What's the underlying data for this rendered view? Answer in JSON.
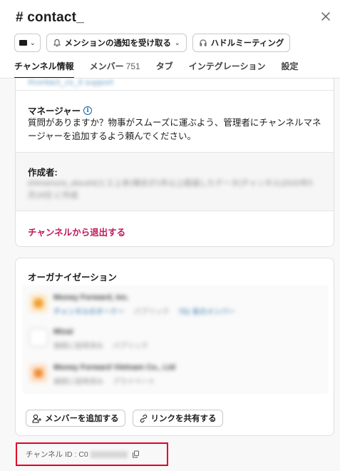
{
  "header": {
    "title": "# contact_",
    "toolbar": {
      "chip_caret": "⌄",
      "notify_label": "メンションの通知を受け取る",
      "notify_caret": "⌄",
      "huddle_label": "ハドルミーティング"
    },
    "tabs": [
      {
        "label": "チャンネル情報",
        "active": true
      },
      {
        "label": "メンバー",
        "count": "751"
      },
      {
        "label": "タブ"
      },
      {
        "label": "インテグレーション"
      },
      {
        "label": "設定"
      }
    ]
  },
  "about": {
    "cut_link": "#contact_cs_it support",
    "managers_heading": "マネージャー",
    "managers_text": "質問がありますか？物事がスムーズに運ぶよう、管理者にチャンネルマネージャーを追加するよう頼んでください。",
    "creator_heading": "作成者:",
    "creator_text": "shimamura_atsushi(ヒエ上本)場合が1年以上経過したデータ(チャンネル)2020年5月18日 に作成",
    "leave_label": "チャンネルから退出する"
  },
  "organizations": {
    "heading": "オーガナイゼーション",
    "items": [
      {
        "name": "Money Forward, Inc.",
        "sub": "チャンネルのオーナー",
        "sub2": "パブリック",
        "sub3": "751 名のメンバー",
        "logo_color": "#f0a030"
      },
      {
        "name": "Mixai",
        "sub": "接続に招待済み",
        "sub2": "パブリック",
        "sub3": "",
        "logo_color": "#ffffff"
      },
      {
        "name": "Money Forward Vietnam Co., Ltd",
        "sub": "接続に招待済み",
        "sub2": "プライベート",
        "sub3": "",
        "logo_color": "#f08a30"
      }
    ],
    "add_member_label": "メンバーを追加する",
    "share_link_label": "リンクを共有する"
  },
  "footer": {
    "channel_id_label": "チャンネル ID : C0"
  },
  "colors": {
    "accent_link": "#1264a3",
    "danger": "#c2185b",
    "highlight_box": "#e0002a"
  }
}
